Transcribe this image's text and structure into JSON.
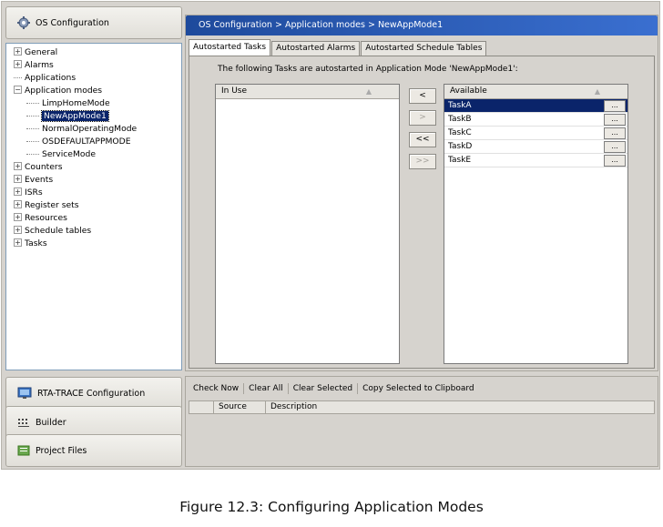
{
  "left_panel": {
    "os_config_button": "OS Configuration",
    "rta_trace_button": "RTA-TRACE Configuration",
    "builder_button": "Builder",
    "project_files_button": "Project Files"
  },
  "tree": {
    "general": "General",
    "alarms": "Alarms",
    "applications": "Applications",
    "application_modes": "Application modes",
    "modes": [
      "LimpHomeMode",
      "NewAppMode1",
      "NormalOperatingMode",
      "OSDEFAULTAPPMODE",
      "ServiceMode"
    ],
    "counters": "Counters",
    "events": "Events",
    "isrs": "ISRs",
    "register_sets": "Register sets",
    "resources": "Resources",
    "schedule_tables": "Schedule tables",
    "tasks": "Tasks",
    "selected": "NewAppMode1"
  },
  "header": {
    "breadcrumb": "OS Configuration  >  Application modes  >  NewAppMode1"
  },
  "tabs": [
    "Autostarted Tasks",
    "Autostarted Alarms",
    "Autostarted Schedule Tables"
  ],
  "main": {
    "description": "The following Tasks are autostarted in Application Mode 'NewAppMode1':",
    "in_use_header": "In Use",
    "available_header": "Available",
    "available_tasks": [
      "TaskA",
      "TaskB",
      "TaskC",
      "TaskD",
      "TaskE"
    ],
    "selected_task": "TaskA",
    "row_button_label": "...",
    "move_buttons": [
      "<",
      ">",
      "<<",
      ">>"
    ]
  },
  "bottom": {
    "toolbar": [
      "Check Now",
      "Clear All",
      "Clear Selected",
      "Copy Selected to Clipboard"
    ],
    "columns": [
      "Source",
      "Description"
    ]
  },
  "caption": "Figure 12.3: Configuring Application Modes",
  "colors": {
    "selection": "#0a246a",
    "title_gradient_start": "#1e4a9c",
    "panel_bg": "#d6d3ce"
  }
}
